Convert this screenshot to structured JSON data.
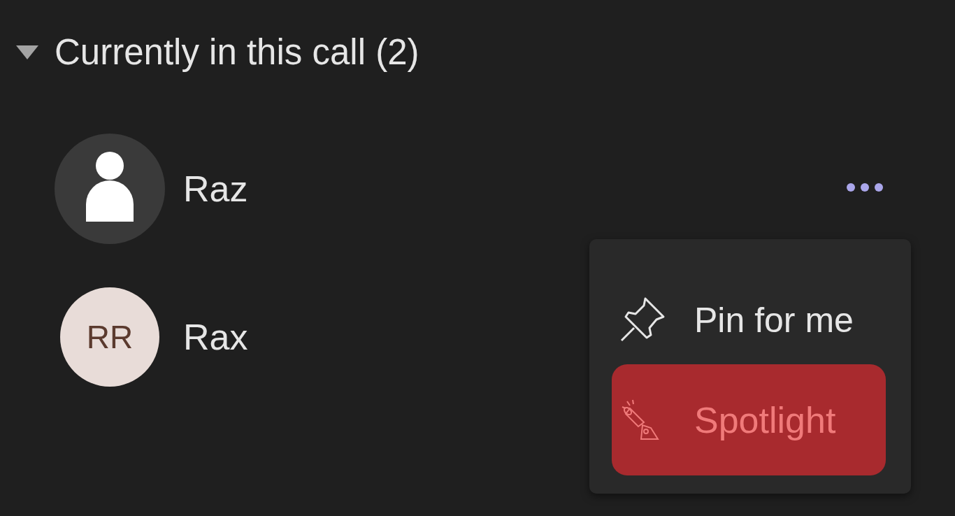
{
  "section": {
    "title": "Currently in this call (2)",
    "expanded": true
  },
  "participants": [
    {
      "name": "Raz",
      "avatar": {
        "kind": "silhouette"
      }
    },
    {
      "name": "Rax",
      "avatar": {
        "kind": "initials",
        "initials": "RR"
      }
    }
  ],
  "menu": {
    "items": [
      {
        "kind": "pin",
        "label": "Pin for me",
        "selected": false
      },
      {
        "kind": "spotlight",
        "label": "Spotlight",
        "selected": true
      }
    ]
  }
}
